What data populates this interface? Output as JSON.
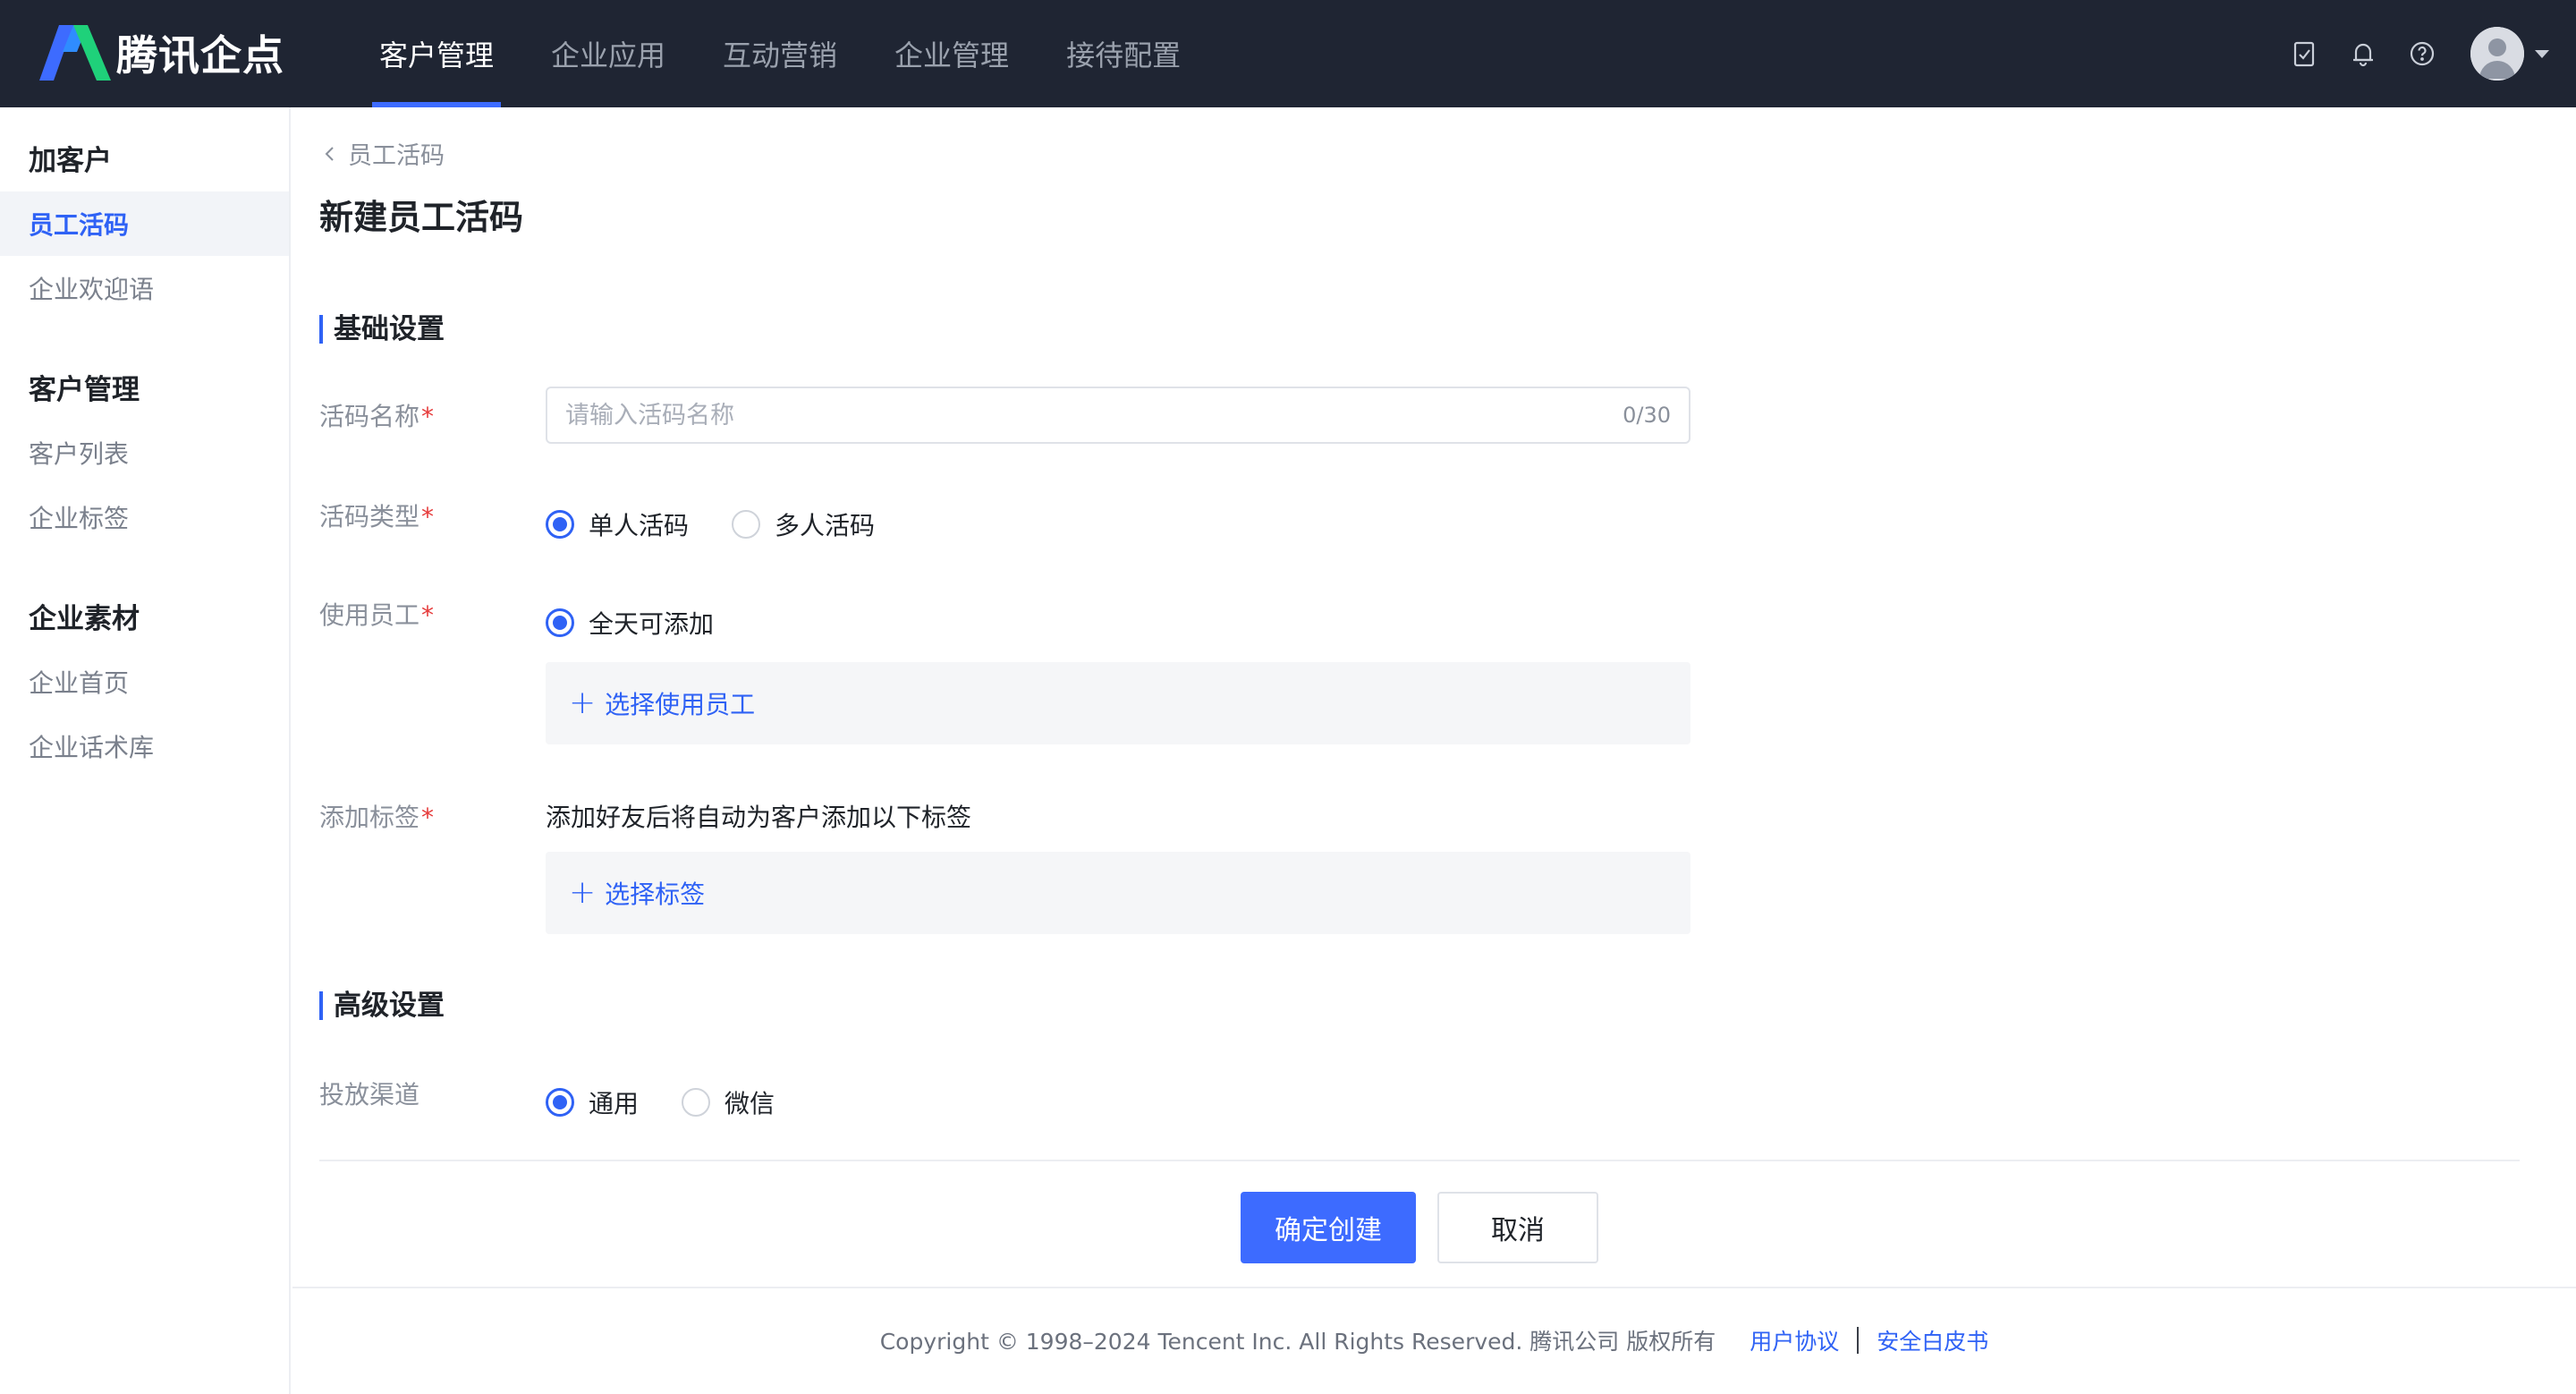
{
  "brand": {
    "name": "腾讯企点"
  },
  "nav": {
    "items": [
      "客户管理",
      "企业应用",
      "互动营销",
      "企业管理",
      "接待配置"
    ]
  },
  "sidebar": {
    "groups": [
      {
        "title": "加客户",
        "items": [
          "员工活码",
          "企业欢迎语"
        ]
      },
      {
        "title": "客户管理",
        "items": [
          "客户列表",
          "企业标签"
        ]
      },
      {
        "title": "企业素材",
        "items": [
          "企业首页",
          "企业话术库"
        ]
      }
    ]
  },
  "page": {
    "breadcrumb": "员工活码",
    "title": "新建员工活码"
  },
  "basic": {
    "section_title": "基础设置",
    "name_label": "活码名称",
    "name_placeholder": "请输入活码名称",
    "name_value": "",
    "name_counter": "0/30",
    "type_label": "活码类型",
    "type_options": [
      "单人活码",
      "多人活码"
    ],
    "type_selected": "单人活码",
    "staff_label": "使用员工",
    "staff_option": "全天可添加",
    "staff_add": "选择使用员工",
    "tag_label": "添加标签",
    "tag_hint": "添加好友后将自动为客户添加以下标签",
    "tag_add": "选择标签",
    "required_mark": "*"
  },
  "advanced": {
    "section_title": "高级设置",
    "channel_label": "投放渠道",
    "channel_options": [
      "通用",
      "微信"
    ],
    "channel_selected": "通用"
  },
  "actions": {
    "confirm": "确定创建",
    "cancel": "取消"
  },
  "footer": {
    "copyright": "Copyright © 1998–2024 Tencent Inc. All Rights Reserved. 腾讯公司 版权所有",
    "link_agreement": "用户协议",
    "link_security": "安全白皮书"
  },
  "colors": {
    "topbar": "#1f2533",
    "accent": "#2f62f5",
    "primary_button": "#3d6bff",
    "required": "#e63b3b"
  }
}
